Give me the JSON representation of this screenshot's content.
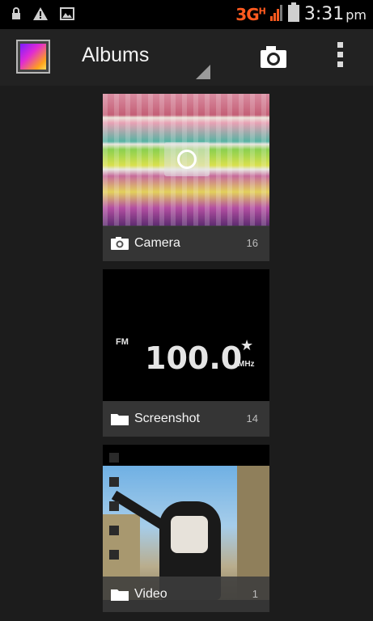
{
  "status_bar": {
    "network": "3G",
    "network_sup": "H",
    "time": "3:31",
    "ampm": "pm"
  },
  "action_bar": {
    "title": "Albums"
  },
  "albums": [
    {
      "label": "Camera",
      "count": "16",
      "icon": "camera-icon"
    },
    {
      "label": "Screenshot",
      "count": "14",
      "icon": "folder-icon",
      "thumb": {
        "fm": "FM",
        "freq": "100.0",
        "unit": "MHz"
      }
    },
    {
      "label": "Video",
      "count": "1",
      "icon": "folder-icon"
    }
  ]
}
